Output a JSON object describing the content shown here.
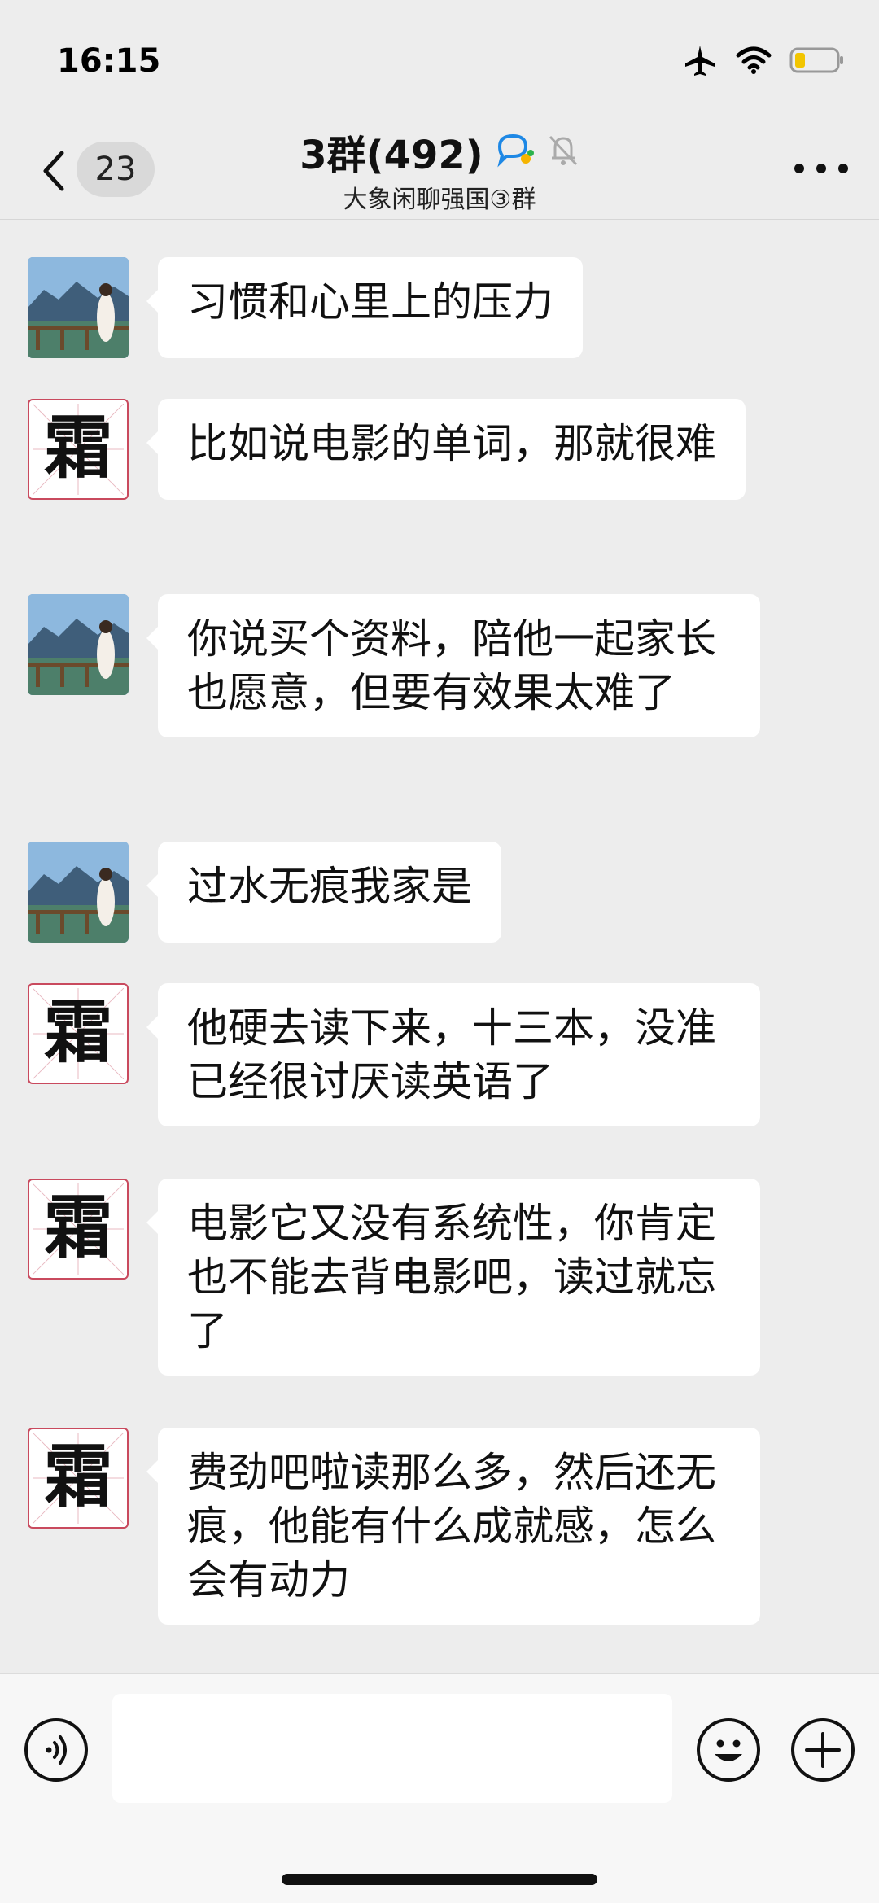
{
  "status_bar": {
    "time": "16:15",
    "icons": [
      "airplane-icon",
      "wifi-icon",
      "battery-icon"
    ]
  },
  "header": {
    "back_label": "",
    "unread_count": "23",
    "title": "3群(492)",
    "subtitle": "大象闲聊强国③群",
    "icons": [
      "chat-bubble-icon",
      "bell-muted-icon",
      "more-icon"
    ]
  },
  "messages": [
    {
      "avatar": "photo",
      "text": "习惯和心里上的压力"
    },
    {
      "avatar": "frost",
      "text": "比如说电影的单词，那就很难"
    },
    {
      "avatar": "photo",
      "text": "你说买个资料，陪他一起家长也愿意，但要有效果太难了"
    },
    {
      "avatar": "photo",
      "text": "过水无痕我家是"
    },
    {
      "avatar": "frost",
      "text": "他硬去读下来，十三本，没准已经很讨厌读英语了"
    },
    {
      "avatar": "frost",
      "text": "电影它又没有系统性，你肯定也不能去背电影吧，读过就忘了"
    },
    {
      "avatar": "frost",
      "text": "费劲吧啦读那么多，然后还无痕，他能有什么成就感，怎么会有动力"
    }
  ],
  "frost_avatar_char": "霜",
  "input": {
    "value": "",
    "placeholder": ""
  },
  "colors": {
    "background": "#ededed",
    "bubble": "#ffffff",
    "frost_border": "#c94a5e",
    "chat_icon_blue": "#1e88e5"
  }
}
